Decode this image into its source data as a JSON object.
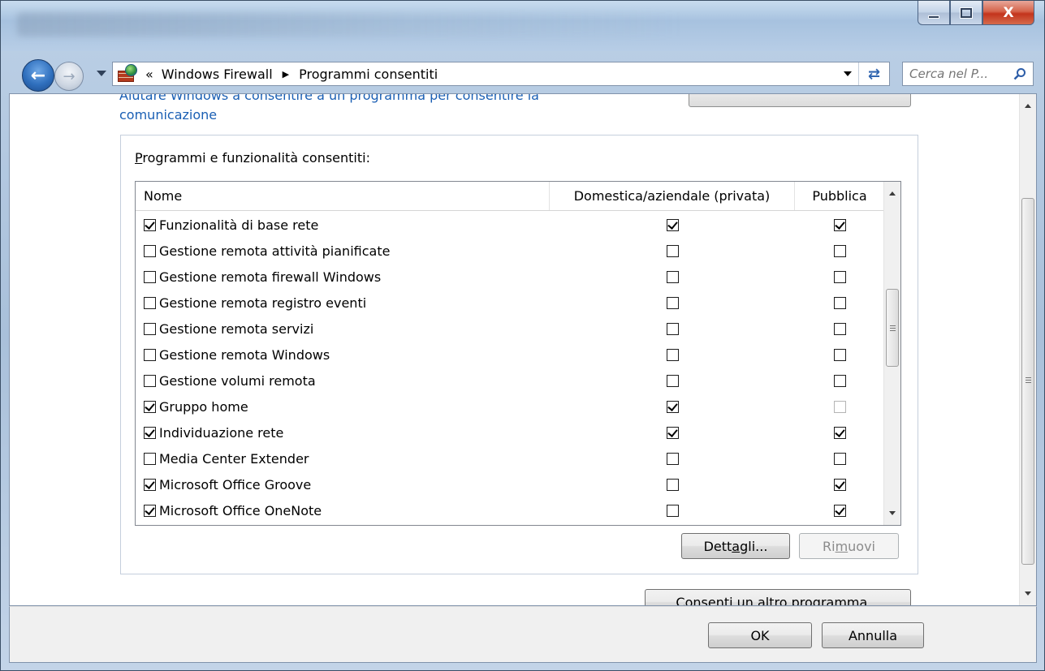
{
  "window": {
    "caption_buttons": {
      "minimize": "minimize",
      "maximize": "maximize",
      "close": "X"
    }
  },
  "address_bar": {
    "overflow_chevron": "«",
    "crumbs": [
      "Windows Firewall",
      "Programmi consentiti"
    ],
    "separator": "▶"
  },
  "search": {
    "placeholder": "Cerca nel P..."
  },
  "content": {
    "link_line1_cut": "Aiutare Windows a consentire a un programma per consentire la",
    "link_line2": "comunicazione",
    "group_label_pre": "P",
    "group_label_rest": "rogrammi e funzionalità consentiti:",
    "columns": {
      "name": "Nome",
      "private": "Domestica/aziendale (privata)",
      "public": "Pubblica"
    },
    "programs": [
      {
        "name": "Funzionalità di base rete",
        "enabled": true,
        "private": true,
        "public": true,
        "public_dim": false
      },
      {
        "name": "Gestione remota attività pianificate",
        "enabled": false,
        "private": false,
        "public": false,
        "public_dim": false
      },
      {
        "name": "Gestione remota firewall Windows",
        "enabled": false,
        "private": false,
        "public": false,
        "public_dim": false
      },
      {
        "name": "Gestione remota registro eventi",
        "enabled": false,
        "private": false,
        "public": false,
        "public_dim": false
      },
      {
        "name": "Gestione remota servizi",
        "enabled": false,
        "private": false,
        "public": false,
        "public_dim": false
      },
      {
        "name": "Gestione remota Windows",
        "enabled": false,
        "private": false,
        "public": false,
        "public_dim": false
      },
      {
        "name": "Gestione volumi remota",
        "enabled": false,
        "private": false,
        "public": false,
        "public_dim": false
      },
      {
        "name": "Gruppo home",
        "enabled": true,
        "private": true,
        "public": false,
        "public_dim": true
      },
      {
        "name": "Individuazione rete",
        "enabled": true,
        "private": true,
        "public": true,
        "public_dim": false
      },
      {
        "name": "Media Center Extender",
        "enabled": false,
        "private": false,
        "public": false,
        "public_dim": false
      },
      {
        "name": "Microsoft Office Groove",
        "enabled": true,
        "private": false,
        "public": true,
        "public_dim": false
      },
      {
        "name": "Microsoft Office OneNote",
        "enabled": true,
        "private": false,
        "public": true,
        "public_dim": false
      }
    ],
    "buttons": {
      "details_pre": "Dett",
      "details_key": "a",
      "details_post": "gli...",
      "remove_pre": "Ri",
      "remove_key": "m",
      "remove_post": "uovi",
      "allow_other": "Consenti un altro programma..."
    }
  },
  "footer": {
    "ok": "OK",
    "cancel": "Annulla"
  }
}
